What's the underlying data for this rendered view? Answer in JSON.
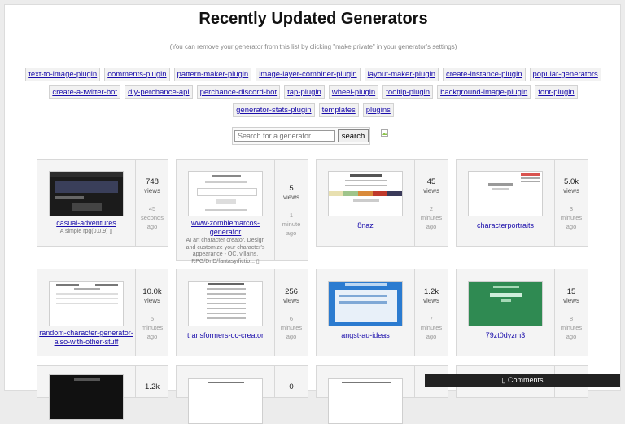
{
  "header": {
    "title": "Recently Updated Generators",
    "subtitle": "(You can remove your generator from this list by clicking \"make private\" in your generator's settings)"
  },
  "tags": [
    [
      "text-to-image-plugin",
      "comments-plugin",
      "pattern-maker-plugin",
      "image-layer-combiner-plugin",
      "layout-maker-plugin",
      "create-instance-plugin",
      "popular-generators"
    ],
    [
      "create-a-twitter-bot",
      "diy-perchance-api",
      "perchance-discord-bot",
      "tap-plugin",
      "wheel-plugin",
      "tooltip-plugin",
      "background-image-plugin",
      "font-plugin"
    ],
    [
      "generator-stats-plugin",
      "templates",
      "plugins"
    ]
  ],
  "search": {
    "placeholder": "Search for a generator...",
    "button": "search"
  },
  "cards": [
    {
      "name": "casual-adventures",
      "desc": "A simple rpg(0.0.9) ▯",
      "views": "748",
      "views_label": "views",
      "ago": [
        "45",
        "seconds",
        "ago"
      ]
    },
    {
      "name": "www-zombiemarcos-generator",
      "desc": "AI art character creator. Design and customize your character's appearance - OC, villains, RPG/DnD/fantasy/fictio... ▯",
      "views": "5",
      "views_label": "views",
      "ago": [
        "1",
        "minute",
        "ago"
      ]
    },
    {
      "name": "8naz",
      "desc": "",
      "views": "45",
      "views_label": "views",
      "ago": [
        "2",
        "minutes",
        "ago"
      ]
    },
    {
      "name": "characterportraits",
      "desc": "",
      "views": "5.0k",
      "views_label": "views",
      "ago": [
        "3",
        "minutes",
        "ago"
      ]
    },
    {
      "name": "random-character-generator-also-with-other-stuff",
      "desc": "",
      "views": "10.0k",
      "views_label": "views",
      "ago": [
        "5",
        "minutes",
        "ago"
      ]
    },
    {
      "name": "transformers-oc-creator",
      "desc": "",
      "views": "256",
      "views_label": "views",
      "ago": [
        "6",
        "minutes",
        "ago"
      ]
    },
    {
      "name": "angst-au-ideas",
      "desc": "",
      "views": "1.2k",
      "views_label": "views",
      "ago": [
        "7",
        "minutes",
        "ago"
      ]
    },
    {
      "name": "79zt0dyzm3",
      "desc": "",
      "views": "15",
      "views_label": "views",
      "ago": [
        "8",
        "minutes",
        "ago"
      ]
    },
    {
      "name": "",
      "desc": "",
      "views": "1.2k",
      "views_label": "",
      "ago": [
        "",
        "",
        ""
      ]
    },
    {
      "name": "",
      "desc": "",
      "views": "0",
      "views_label": "",
      "ago": [
        "",
        "",
        ""
      ]
    },
    {
      "name": "",
      "desc": "",
      "views": "",
      "views_label": "",
      "ago": [
        "",
        "",
        ""
      ]
    },
    {
      "name": "",
      "desc": "",
      "views": "",
      "views_label": "",
      "ago": [
        "",
        "",
        ""
      ]
    }
  ],
  "comments_bar": {
    "label": "▯ Comments"
  },
  "colors": {
    "link": "#1a0dab",
    "card_bg": "#f4f4f4",
    "comments_bg": "#222222"
  }
}
